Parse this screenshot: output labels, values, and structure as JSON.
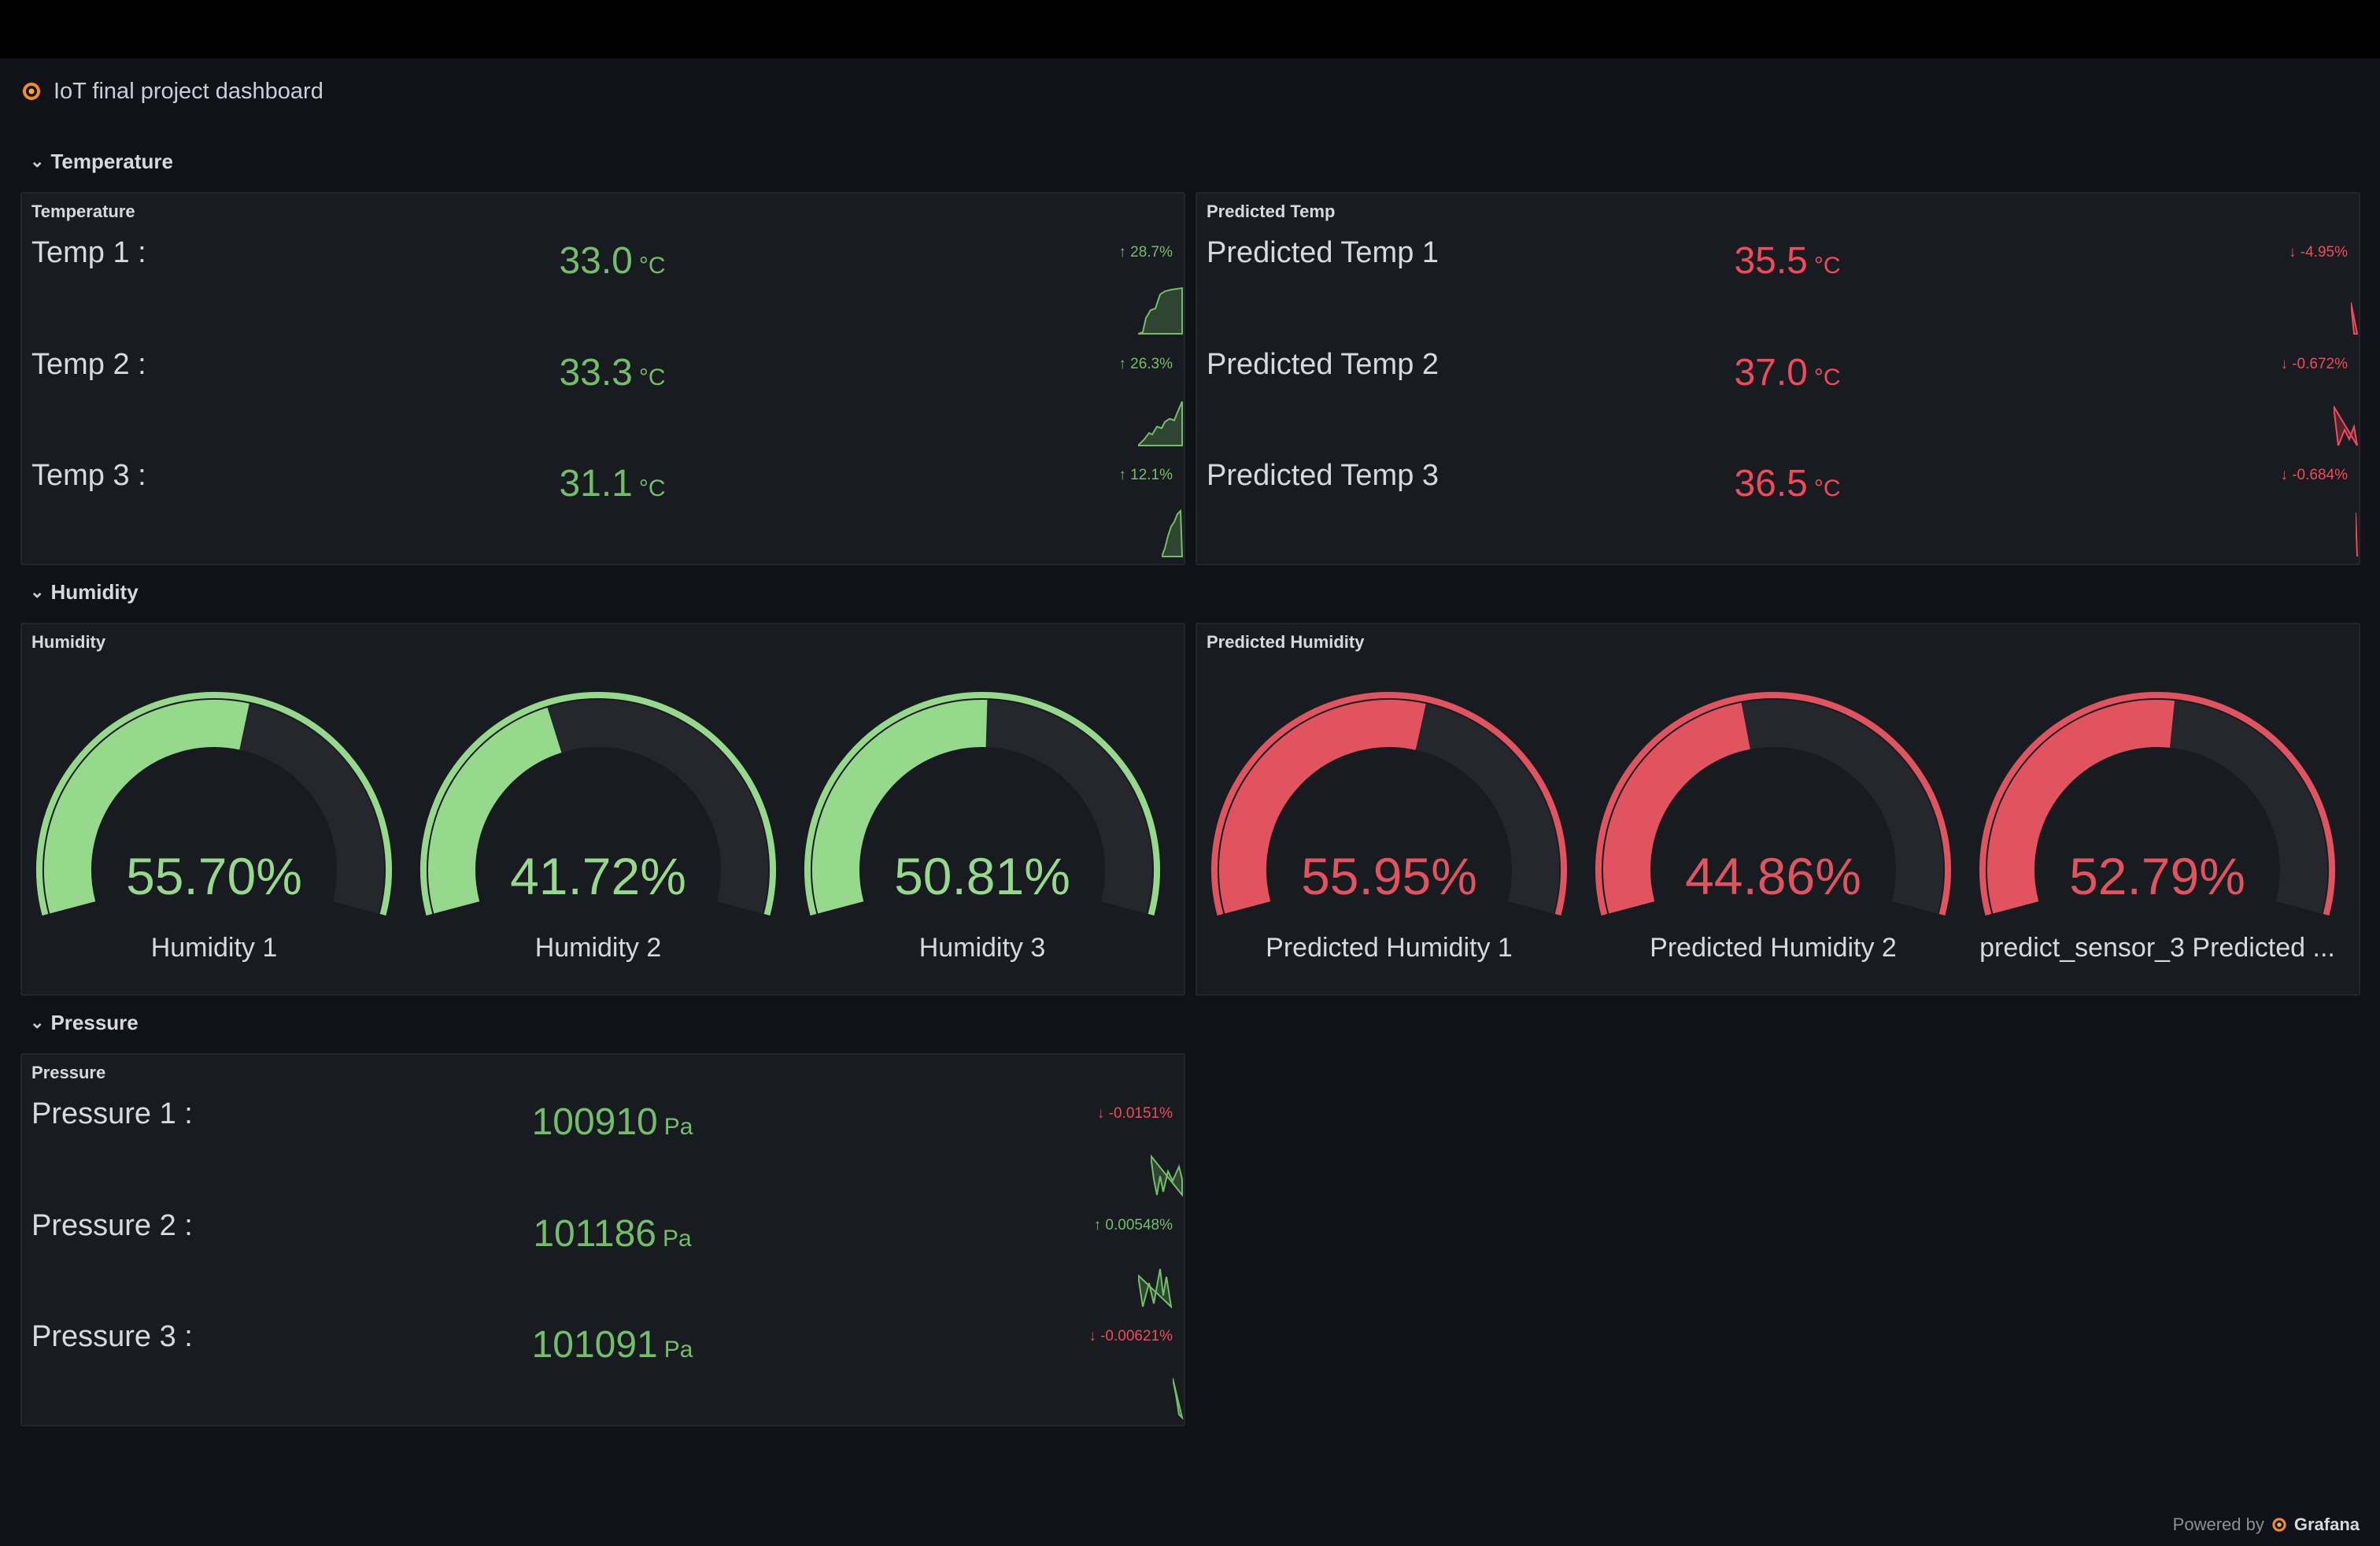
{
  "dashboard": {
    "title": "IoT final project dashboard",
    "footer": {
      "powered_by": "Powered by",
      "brand": "Grafana"
    }
  },
  "colors": {
    "green": "#73bf69",
    "green_gauge": "#96d98d",
    "red": "#f2495c",
    "red_gauge": "#e0535f",
    "panel_bg": "#181b1f",
    "page_bg": "#111217"
  },
  "icons": {
    "logo": "grafana-logo-icon",
    "row_collapse": "chevron-down-icon",
    "delta_up": "arrow-up-icon",
    "delta_down": "arrow-down-icon"
  },
  "rows": [
    {
      "title": "Temperature"
    },
    {
      "title": "Humidity"
    },
    {
      "title": "Pressure"
    }
  ],
  "temperature_panel": {
    "title": "Temperature",
    "stats": [
      {
        "name": "Temp 1 :",
        "value": "33.0",
        "unit": "°C",
        "delta": "28.7%",
        "direction": "up",
        "color": "#73bf69"
      },
      {
        "name": "Temp 2 :",
        "value": "33.3",
        "unit": "°C",
        "delta": "26.3%",
        "direction": "up",
        "color": "#73bf69"
      },
      {
        "name": "Temp 3 :",
        "value": "31.1",
        "unit": "°C",
        "delta": "12.1%",
        "direction": "up",
        "color": "#73bf69"
      }
    ]
  },
  "predicted_temp_panel": {
    "title": "Predicted Temp",
    "stats": [
      {
        "name": "Predicted Temp 1",
        "value": "35.5",
        "unit": "°C",
        "delta": "-4.95%",
        "direction": "down",
        "color": "#f2495c"
      },
      {
        "name": "Predicted Temp 2",
        "value": "37.0",
        "unit": "°C",
        "delta": "-0.672%",
        "direction": "down",
        "color": "#f2495c"
      },
      {
        "name": "Predicted Temp 3",
        "value": "36.5",
        "unit": "°C",
        "delta": "-0.684%",
        "direction": "down",
        "color": "#f2495c"
      }
    ]
  },
  "humidity_panel": {
    "title": "Humidity",
    "gauges": [
      {
        "label": "Humidity 1",
        "value": "55.70%",
        "fraction": 0.557
      },
      {
        "label": "Humidity 2",
        "value": "41.72%",
        "fraction": 0.4172
      },
      {
        "label": "Humidity 3",
        "value": "50.81%",
        "fraction": 0.5081
      }
    ]
  },
  "predicted_humidity_panel": {
    "title": "Predicted Humidity",
    "gauges": [
      {
        "label": "Predicted Humidity 1",
        "value": "55.95%",
        "fraction": 0.5595
      },
      {
        "label": "Predicted Humidity 2",
        "value": "44.86%",
        "fraction": 0.4486
      },
      {
        "label": "predict_sensor_3 Predicted ...",
        "value": "52.79%",
        "fraction": 0.5279
      }
    ]
  },
  "pressure_panel": {
    "title": "Pressure",
    "stats": [
      {
        "name": "Pressure 1 :",
        "value": "100910",
        "unit": "Pa",
        "delta": "-0.0151%",
        "direction": "down",
        "color": "#73bf69"
      },
      {
        "name": "Pressure 2 :",
        "value": "101186",
        "unit": "Pa",
        "delta": "0.00548%",
        "direction": "up",
        "color": "#73bf69"
      },
      {
        "name": "Pressure 3 :",
        "value": "101091",
        "unit": "Pa",
        "delta": "-0.00621%",
        "direction": "down",
        "color": "#73bf69"
      }
    ]
  }
}
